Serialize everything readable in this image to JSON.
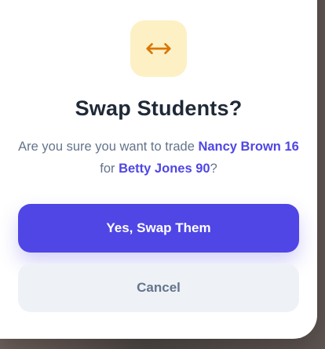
{
  "dialog": {
    "icon": "swap-horizontal-icon",
    "title": "Swap Students?",
    "message_prefix": "Are you sure you want to trade ",
    "student_a": "Nancy Brown 16",
    "message_middle": " for ",
    "student_b": "Betty Jones 90",
    "message_suffix": "?",
    "confirm_label": "Yes, Swap Them",
    "cancel_label": "Cancel"
  },
  "colors": {
    "icon_bg": "#fdf0c4",
    "icon_fg": "#d97706",
    "accent": "#4f46e5",
    "highlight": "#4f46e5",
    "cancel_bg": "#eef2f7"
  }
}
